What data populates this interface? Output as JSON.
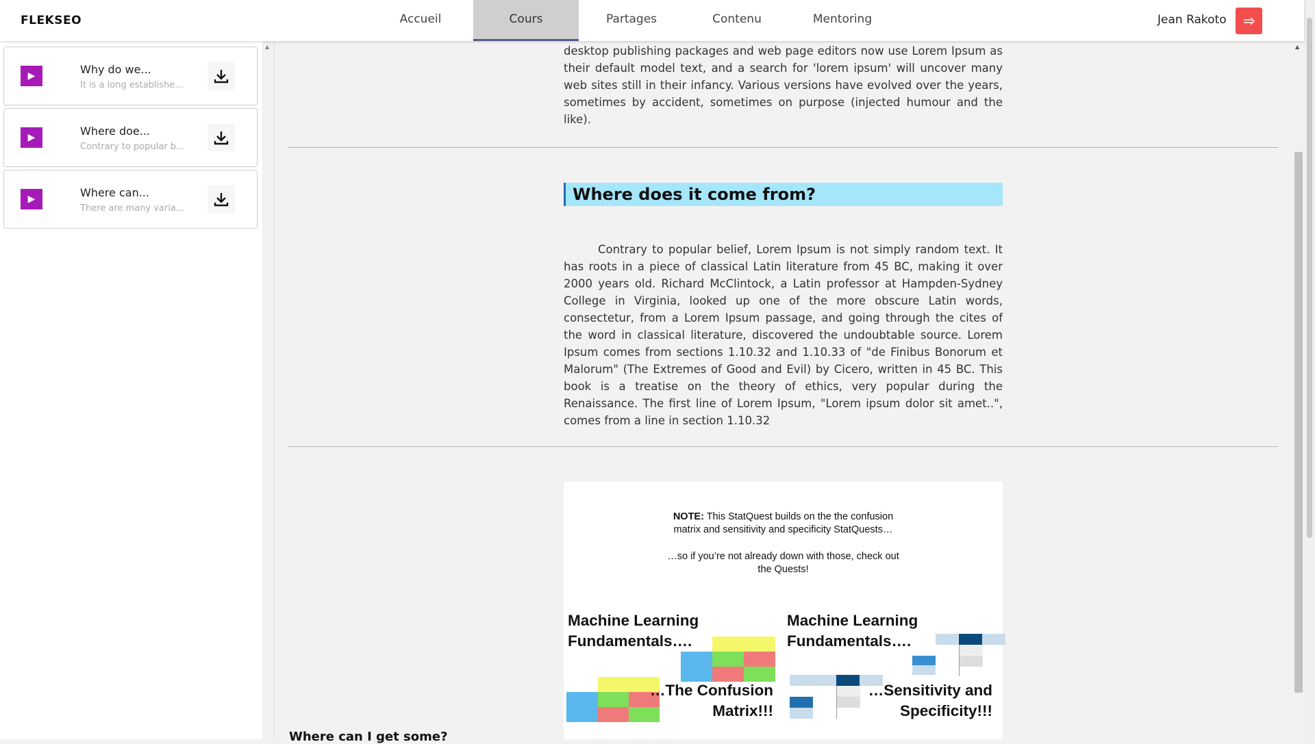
{
  "header": {
    "brand": "FLEKSEO",
    "nav": [
      {
        "label": "Accueil"
      },
      {
        "label": "Cours",
        "active": true
      },
      {
        "label": "Partages"
      },
      {
        "label": "Contenu"
      },
      {
        "label": "Mentoring"
      }
    ],
    "user_name": "Jean Rakoto",
    "logout_icon": "arrow-right-icon",
    "accent_color": "#f44d4d"
  },
  "lessons": [
    {
      "title": "Why do we...",
      "subtitle": "It is a long establishe...",
      "icon": "play-icon",
      "action_icon": "download-icon"
    },
    {
      "title": "Where doe...",
      "subtitle": "Contrary to popular b...",
      "icon": "play-icon",
      "action_icon": "download-icon"
    },
    {
      "title": "Where can...",
      "subtitle": "There are many varia...",
      "icon": "play-icon",
      "action_icon": "download-icon"
    }
  ],
  "content": {
    "top_paragraph": "desktop publishing packages and web page editors now use Lorem Ipsum as their default model text, and a search for 'lorem ipsum' will uncover many web sites still in their infancy. Various versions have evolved over the years, sometimes by accident, sometimes on purpose (injected humour and the like).",
    "section_title": "Where does it come from?",
    "section_paragraph": "Contrary to popular belief, Lorem Ipsum is not simply random text. It has roots in a piece of classical Latin literature from 45 BC, making it over 2000 years old. Richard McClintock, a Latin professor at Hampden-Sydney College in Virginia, looked up one of the more obscure Latin words, consectetur, from a Lorem Ipsum passage, and going through the cites of the word in classical literature, discovered the undoubtable source. Lorem Ipsum comes from sections 1.10.32 and 1.10.33 of \"de Finibus Bonorum et Malorum\" (The Extremes of Good and Evil) by Cicero, written in 45 BC. This book is a treatise on the theory of ethics, very popular during the Renaissance. The first line of Lorem Ipsum, \"Lorem ipsum dolor sit amet..\", comes from a line in section 1.10.32",
    "slide": {
      "note_bold": "NOTE:",
      "note_line1": " This StatQuest builds on the the confusion",
      "note_line2": "matrix and sensitivity and specificity StatQuests…",
      "note_line3": "…so if you’re not already down with those, check out",
      "note_line4": "the Quests!",
      "left_title_1": "Machine Learning",
      "left_title_2": "Fundamentals….",
      "left_sub_1": "…The Confusion",
      "left_sub_2": "Matrix!!!",
      "right_title_1": "Machine Learning",
      "right_title_2": "Fundamentals….",
      "right_sub_1": "…Sensitivity and",
      "right_sub_2": "Specificity!!!"
    },
    "trailing_heading": "Where can I get some?"
  }
}
